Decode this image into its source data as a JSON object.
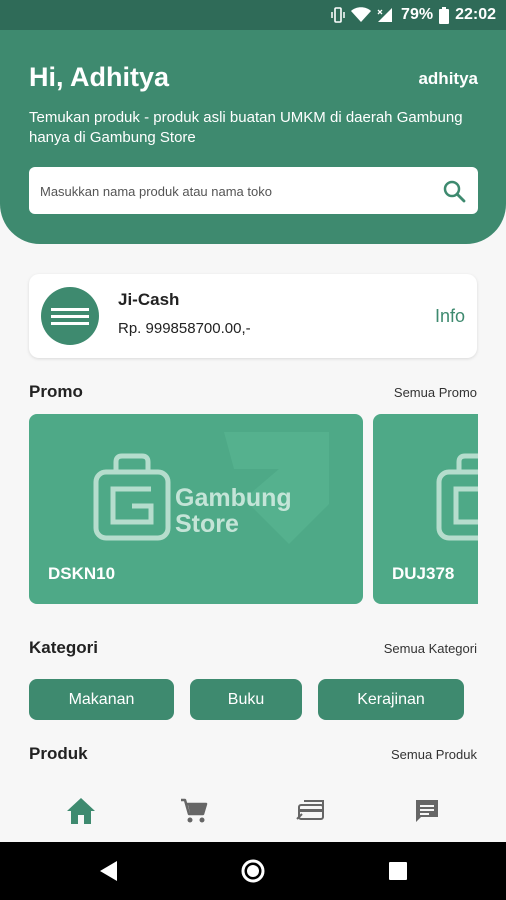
{
  "status_bar": {
    "battery": "79%",
    "time": "22:02",
    "icons": [
      "vibrate-icon",
      "wifi-icon",
      "signal-icon",
      "battery-icon"
    ]
  },
  "header": {
    "greeting": "Hi, Adhitya",
    "username": "adhitya",
    "subtitle": "Temukan produk - produk asli buatan UMKM di daerah Gambung hanya di Gambung Store",
    "search_placeholder": "Masukkan nama produk atau nama toko"
  },
  "wallet": {
    "name": "Ji-Cash",
    "balance": "Rp. 999858700.00,-",
    "info_label": "Info"
  },
  "promo": {
    "title": "Promo",
    "see_all": "Semua Promo",
    "items": [
      {
        "code": "DSKN10",
        "brand": "Gambung",
        "brand_sub": "Store"
      },
      {
        "code": "DUJ378"
      }
    ]
  },
  "kategori": {
    "title": "Kategori",
    "see_all": "Semua Kategori",
    "items": [
      "Makanan",
      "Buku",
      "Kerajinan"
    ]
  },
  "produk": {
    "title": "Produk",
    "see_all": "Semua Produk"
  },
  "bottom_nav": [
    "home-icon",
    "cart-icon",
    "payment-icon",
    "chat-icon"
  ],
  "colors": {
    "primary": "#3e8a6f",
    "primary_dark": "#2f6b58",
    "promo_bg": "#4ea987",
    "background": "#f7f7f7"
  }
}
